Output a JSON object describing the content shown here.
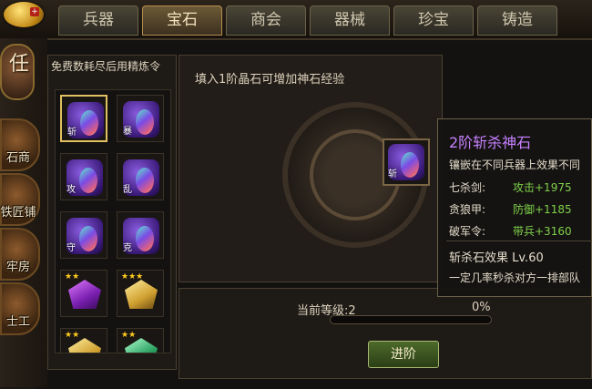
{
  "colors": {
    "accent_gold": "#e0c060",
    "tooltip_title": "#c680ff",
    "stat_green": "#7fd14a"
  },
  "tabs": [
    {
      "label": "兵器",
      "active": false
    },
    {
      "label": "宝石",
      "active": true
    },
    {
      "label": "商会",
      "active": false
    },
    {
      "label": "器械",
      "active": false
    },
    {
      "label": "珍宝",
      "active": false
    },
    {
      "label": "铸造",
      "active": false
    }
  ],
  "sidebar": {
    "title_char": "任",
    "items": [
      {
        "label": "石商",
        "icon": "merchant-icon"
      },
      {
        "label": "铁匠铺",
        "icon": "blacksmith-icon"
      },
      {
        "label": "牢房",
        "icon": "prison-icon"
      },
      {
        "label": "士工",
        "icon": "worker-icon"
      }
    ]
  },
  "inventory": {
    "title": "免费数耗尽后用精炼令",
    "items": [
      {
        "char": "斩",
        "kind": "gem"
      },
      {
        "char": "暴",
        "kind": "gem"
      },
      {
        "char": "攻",
        "kind": "gem"
      },
      {
        "char": "乱",
        "kind": "gem"
      },
      {
        "char": "守",
        "kind": "gem"
      },
      {
        "char": "克",
        "kind": "gem"
      },
      {
        "char": "",
        "kind": "crystal-purple"
      },
      {
        "char": "",
        "kind": "crystal-gold"
      },
      {
        "char": "",
        "kind": "crystal-gold"
      },
      {
        "char": "",
        "kind": "crystal-green"
      }
    ]
  },
  "center": {
    "info": "填入1阶晶石可增加神石经验",
    "slot_char": "斩",
    "level_text": "当前等级:2",
    "progress_text": "0%",
    "progress": 0,
    "advance_button": "进阶"
  },
  "tooltip": {
    "title": "2阶斩杀神石",
    "subtitle": "镶嵌在不同兵器上效果不同",
    "stats": [
      {
        "name": "七杀剑:",
        "value": "攻击+1975"
      },
      {
        "name": "贪狼甲:",
        "value": "防御+1185"
      },
      {
        "name": "破军令:",
        "value": "带兵+3160"
      }
    ],
    "effect": "斩杀石效果 Lv.60",
    "description": "一定几率秒杀对方一排部队"
  }
}
